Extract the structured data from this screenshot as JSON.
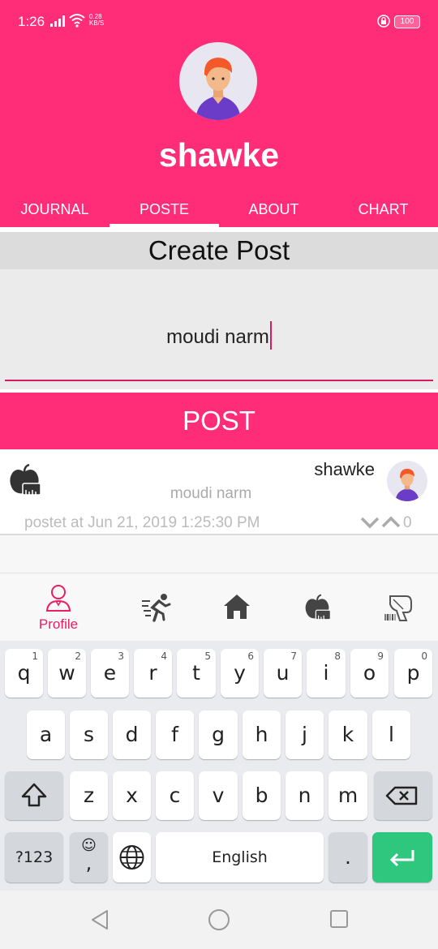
{
  "status_bar": {
    "time": "1:26",
    "speed_value": "0.28",
    "speed_unit": "KB/S",
    "battery": "100",
    "signal_icon": "signal-icon",
    "wifi_icon": "wifi-icon",
    "lock_icon": "lock-icon"
  },
  "profile": {
    "username": "shawke"
  },
  "tabs": [
    {
      "label": "JOURNAL",
      "active": false
    },
    {
      "label": "POSTE",
      "active": true
    },
    {
      "label": "ABOUT",
      "active": false
    },
    {
      "label": "CHART",
      "active": false
    }
  ],
  "create_post": {
    "title": "Create Post",
    "input_value": "moudi narm",
    "button_label": "POST"
  },
  "feed": {
    "items": [
      {
        "icon": "apple-scale-icon",
        "user": "shawke",
        "text": "moudi narm",
        "posted": "postet at Jun 21, 2019 1:25:30 PM",
        "votes": "0"
      }
    ]
  },
  "bottom_nav": {
    "items": [
      {
        "label": "Profile",
        "icon": "profile-icon",
        "active": true
      },
      {
        "label": "",
        "icon": "runner-icon",
        "active": false
      },
      {
        "label": "",
        "icon": "home-icon",
        "active": false
      },
      {
        "label": "",
        "icon": "apple-scale-icon",
        "active": false
      },
      {
        "label": "",
        "icon": "barcode-scanner-icon",
        "active": false
      }
    ]
  },
  "keyboard": {
    "row1": [
      {
        "ch": "q",
        "hint": "1"
      },
      {
        "ch": "w",
        "hint": "2"
      },
      {
        "ch": "e",
        "hint": "3"
      },
      {
        "ch": "r",
        "hint": "4"
      },
      {
        "ch": "t",
        "hint": "5"
      },
      {
        "ch": "y",
        "hint": "6"
      },
      {
        "ch": "u",
        "hint": "7"
      },
      {
        "ch": "i",
        "hint": "8"
      },
      {
        "ch": "o",
        "hint": "9"
      },
      {
        "ch": "p",
        "hint": "0"
      }
    ],
    "row2": [
      "a",
      "s",
      "d",
      "f",
      "g",
      "h",
      "j",
      "k",
      "l"
    ],
    "row3": [
      "z",
      "x",
      "c",
      "v",
      "b",
      "n",
      "m"
    ],
    "sym_label": "?123",
    "emoji_top": "☺",
    "emoji_bottom": ",",
    "space_label": "English",
    "period_label": ".",
    "accent_color": "#2EC77D"
  },
  "colors": {
    "primary": "#FF2D77",
    "accent_line": "#D81B60",
    "nav_active": "#E91E63"
  }
}
